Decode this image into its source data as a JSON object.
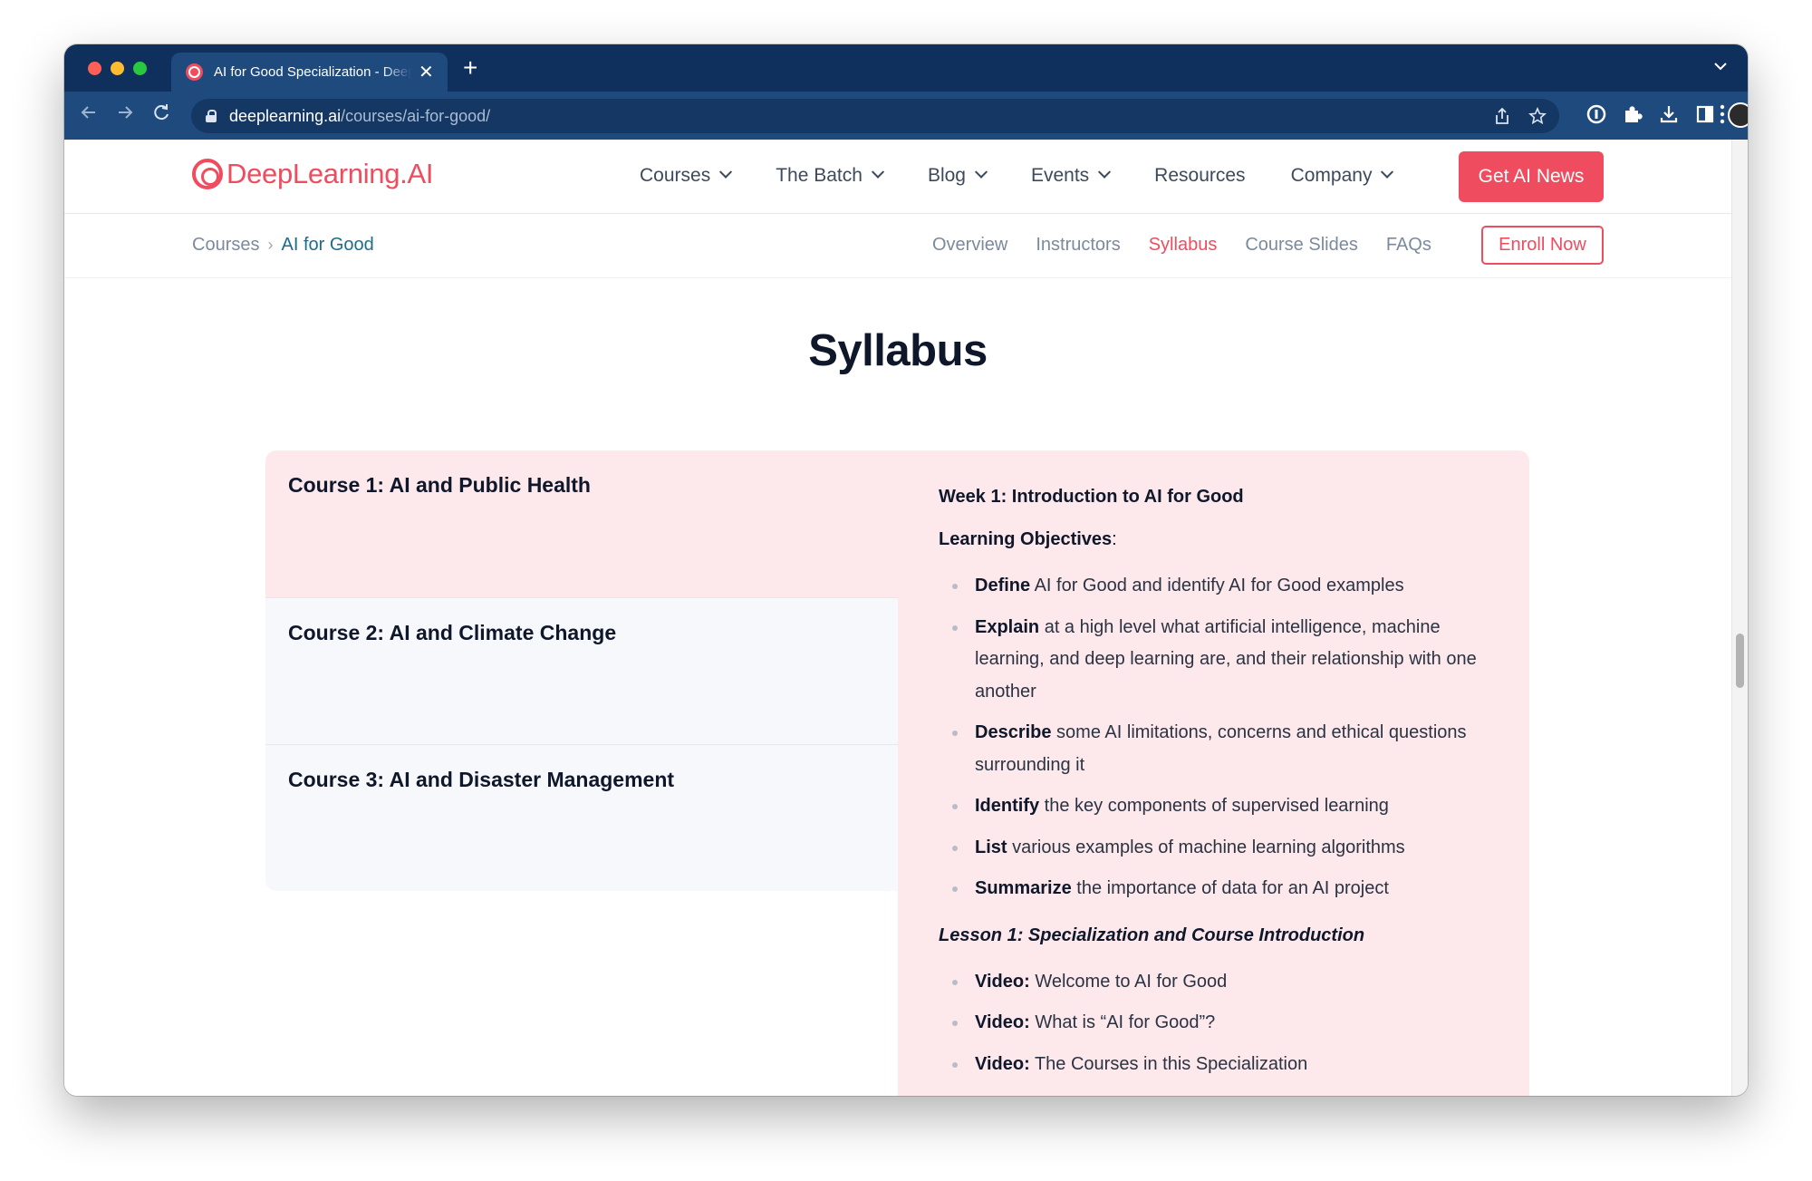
{
  "browser": {
    "tab_title": "AI for Good Specialization - DeepLearning.AI",
    "tab_close": "✕",
    "new_tab": "+",
    "tab_list_icon": "⌄",
    "url_host": "deeplearning.ai",
    "url_path": "/courses/ai-for-good/",
    "icons": [
      "back-arrow-icon",
      "forward-arrow-icon",
      "reload-icon",
      "lock-icon",
      "share-icon",
      "bookmark-star-icon",
      "password-manager-icon",
      "extensions-puzzle-icon",
      "download-icon",
      "side-panel-icon",
      "profile-avatar-icon",
      "kebab-menu-icon"
    ]
  },
  "site": {
    "logo_text": "DeepLearning.AI",
    "brand_color": "#ef4c5f",
    "nav": {
      "courses": "Courses",
      "batch": "The Batch",
      "blog": "Blog",
      "events": "Events",
      "resources": "Resources",
      "company": "Company"
    },
    "cta_news": "Get AI News"
  },
  "subnav": {
    "breadcrumb_root": "Courses",
    "breadcrumb_sep": "›",
    "breadcrumb_current": "AI for Good",
    "overview": "Overview",
    "instructors": "Instructors",
    "syllabus": "Syllabus",
    "slides": "Course Slides",
    "faqs": "FAQs",
    "enroll": "Enroll Now"
  },
  "syllabus": {
    "title": "Syllabus",
    "courses": [
      "Course 1: AI and Public Health",
      "Course 2: AI and Climate Change",
      "Course 3: AI and Disaster Management"
    ],
    "week_title": "Week 1: Introduction to AI for Good",
    "lo_label": "Learning Objectives",
    "lo_suffix": ":",
    "objectives": [
      {
        "verb": "Define",
        "text": " AI for Good and identify AI for Good examples"
      },
      {
        "verb": "Explain",
        "text": " at a high level what artificial intelligence, machine learning, and deep learning are, and their relationship with one another"
      },
      {
        "verb": "Describe",
        "text": " some AI limitations, concerns and ethical questions surrounding it"
      },
      {
        "verb": "Identify",
        "text": " the key components of supervised learning"
      },
      {
        "verb": "List",
        "text": " various examples of machine learning algorithms"
      },
      {
        "verb": "Summarize",
        "text": " the importance of data for an AI project"
      }
    ],
    "lesson_title": "Lesson 1: Specialization and Course Introduction",
    "lesson_items": [
      {
        "label": "Video:",
        "text": " Welcome to AI for Good"
      },
      {
        "label": "Video:",
        "text": " What is “AI for Good”?"
      },
      {
        "label": "Video:",
        "text": " The Courses in this Specialization"
      }
    ]
  }
}
